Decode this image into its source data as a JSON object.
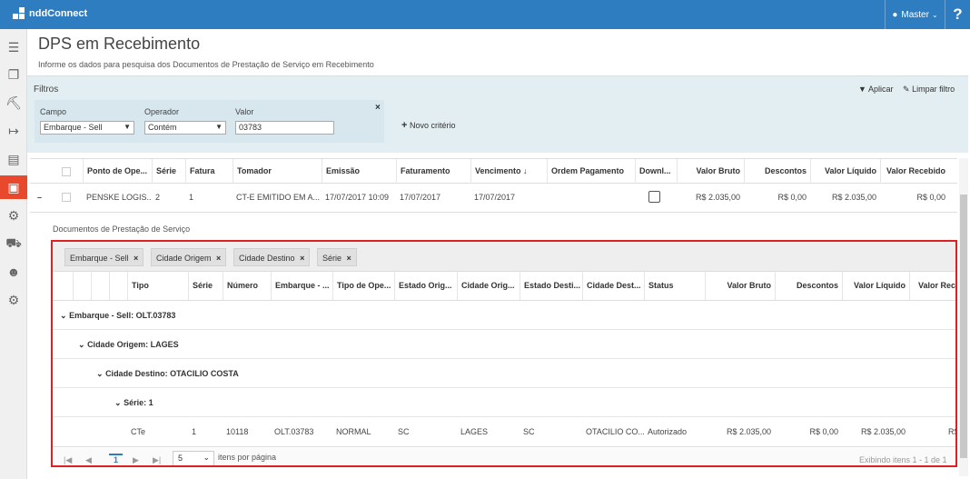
{
  "app": {
    "brand": "nddConnect",
    "user": "Master",
    "help": "?"
  },
  "sidebar": {
    "icons": [
      "menu-icon",
      "documents-icon",
      "truck-icon",
      "export-icon",
      "document-icon",
      "money-icon",
      "gear-dollar-icon",
      "truck-fast-icon",
      "users-icon",
      "settings-icon"
    ]
  },
  "page": {
    "title": "DPS em Recebimento",
    "subtitle": "Informe os dados para pesquisa dos Documentos de Prestação de Serviço em Recebimento"
  },
  "filters": {
    "label": "Filtros",
    "apply": "Aplicar",
    "clear": "Limpar filtro",
    "campo_label": "Campo",
    "campo_value": "Embarque - Sell",
    "operador_label": "Operador",
    "operador_value": "Contém",
    "valor_label": "Valor",
    "valor_value": "03783",
    "remove": "×",
    "new_criteria": "Novo critério"
  },
  "main_table": {
    "headers": [
      "Ponto de Ope...",
      "Série",
      "Fatura",
      "Tomador",
      "Emissão",
      "Faturamento",
      "Vencimento ↓",
      "Ordem Pagamento",
      "Downl...",
      "Valor Bruto",
      "Descontos",
      "Valor Líquido",
      "Valor Recebido"
    ],
    "row": {
      "toggle": "–",
      "ponto": "PENSKE LOGIS...",
      "serie": "2",
      "fatura": "1",
      "tomador": "CT-E EMITIDO EM A...",
      "emissao": "17/07/2017 10:09",
      "faturamento": "17/07/2017",
      "vencimento": "17/07/2017",
      "ordem": "",
      "valor_bruto": "R$ 2.035,00",
      "descontos": "R$ 0,00",
      "valor_liquido": "R$ 2.035,00",
      "valor_recebido": "R$ 0,00"
    }
  },
  "detail": {
    "label": "Documentos de Prestação de Serviço",
    "chips": [
      "Embarque - Sell",
      "Cidade Origem",
      "Cidade Destino",
      "Série"
    ],
    "chip_close": "×",
    "headers": [
      "Tipo",
      "Série",
      "Número",
      "Embarque - ...",
      "Tipo de Ope...",
      "Estado Orig...",
      "Cidade Orig...",
      "Estado Desti...",
      "Cidade Dest...",
      "Status",
      "Valor Bruto",
      "Descontos",
      "Valor Líquido",
      "Valor Rece"
    ],
    "groups": [
      "Embarque - Sell: OLT.03783",
      "Cidade Origem: LAGES",
      "Cidade Destino: OTACILIO COSTA",
      "Série: 1"
    ],
    "row": {
      "tipo": "CTe",
      "serie": "1",
      "numero": "10118",
      "embarque": "OLT.03783",
      "tipo_op": "NORMAL",
      "estado_orig": "SC",
      "cidade_orig": "LAGES",
      "estado_dest": "SC",
      "cidade_dest": "OTACILIO CO...",
      "status": "Autorizado",
      "valor_bruto": "R$ 2.035,00",
      "descontos": "R$ 0,00",
      "valor_liquido": "R$ 2.035,00",
      "valor_recebido": "R$"
    },
    "pager": {
      "page": "1",
      "page_size": "5",
      "per_page_label": "itens por página",
      "summary": "Exibindo itens 1 - 1 de 1"
    }
  }
}
